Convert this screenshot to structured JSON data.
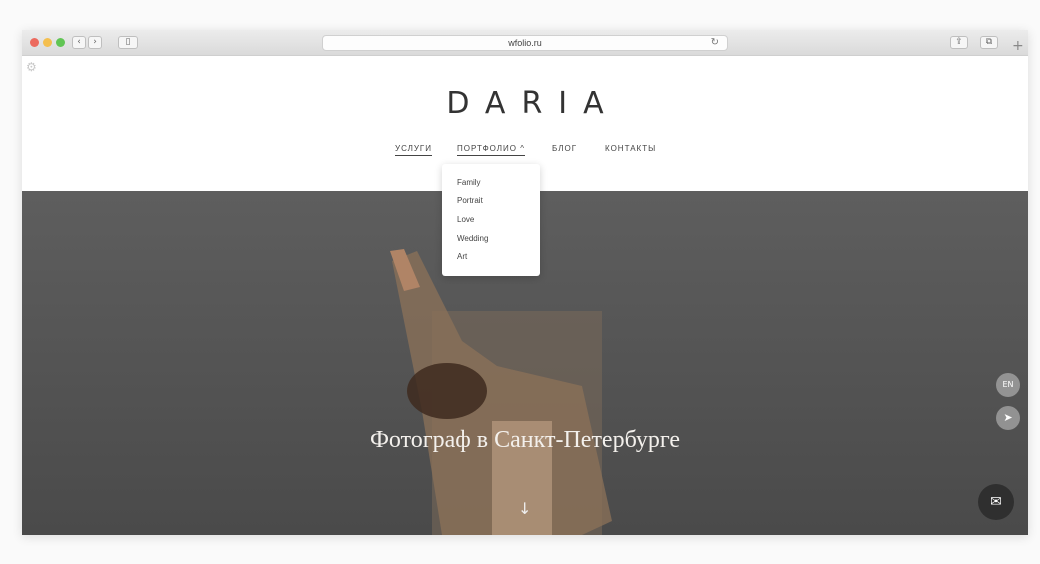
{
  "browser": {
    "url": "wfolio.ru",
    "traffic_lights": [
      "#ec6a5e",
      "#f4bf4f",
      "#61c554"
    ]
  },
  "site": {
    "logo": "DARIA",
    "nav": [
      {
        "label": "УСЛУГИ"
      },
      {
        "label": "ПОРТФОЛИО ^"
      },
      {
        "label": "БЛОГ"
      },
      {
        "label": "КОНТАКТЫ"
      }
    ],
    "portfolio_menu": [
      "Family",
      "Portrait",
      "Love",
      "Wedding",
      "Art"
    ],
    "hero_title": "Фотограф в Санкт-Петербурге",
    "lang_button": "EN"
  },
  "icons": {
    "gear": "gear-icon",
    "scroll_down": "arrow-down-icon",
    "send": "send-icon",
    "chat": "chat-icon"
  }
}
